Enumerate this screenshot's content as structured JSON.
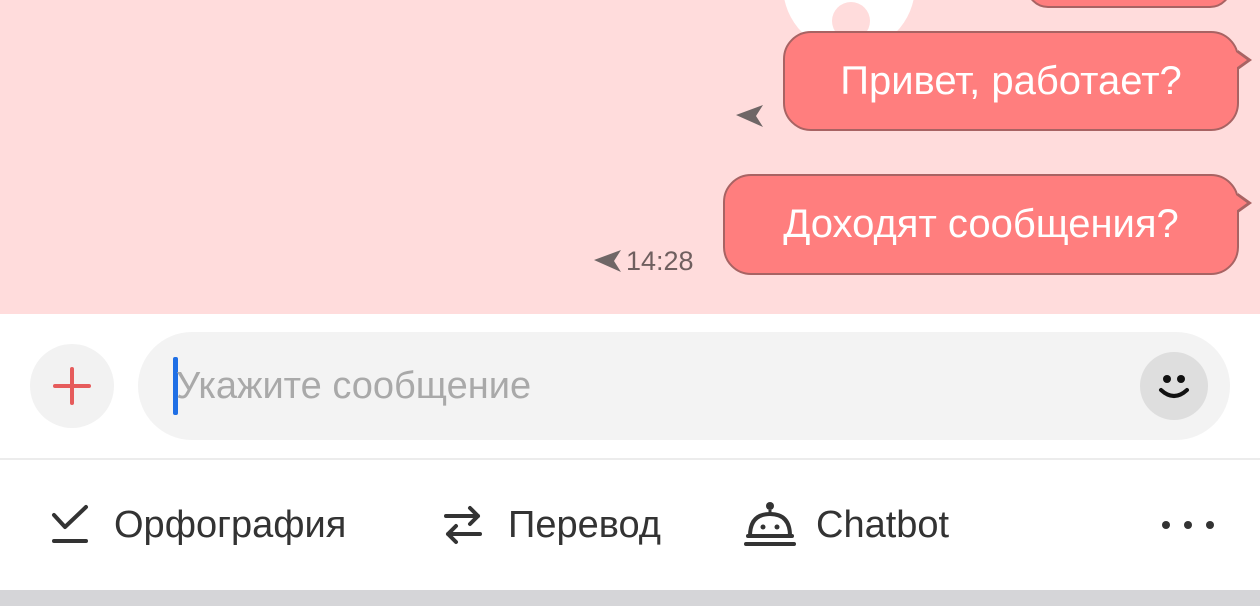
{
  "chat": {
    "messages": [
      {
        "text": "Привет, работает?",
        "time": ""
      },
      {
        "text": "Доходят сообщения?",
        "time": "14:28"
      }
    ],
    "colors": {
      "background": "#ffdcdc",
      "bubble": "#ff7e7e",
      "bubble_border": "#a86363"
    }
  },
  "composer": {
    "placeholder": "Укажите сообщение",
    "add_icon": "plus-icon",
    "emoji_icon": "smiley-icon",
    "accent_color": "#e65c5c",
    "caret_color": "#1f6fe5"
  },
  "toolbar": {
    "items": [
      {
        "label": "Орфография",
        "icon": "checkmark-underline-icon"
      },
      {
        "label": "Перевод",
        "icon": "swap-arrows-icon"
      },
      {
        "label": "Chatbot",
        "icon": "bell-bot-icon"
      }
    ],
    "more_icon": "more-dots-icon"
  }
}
